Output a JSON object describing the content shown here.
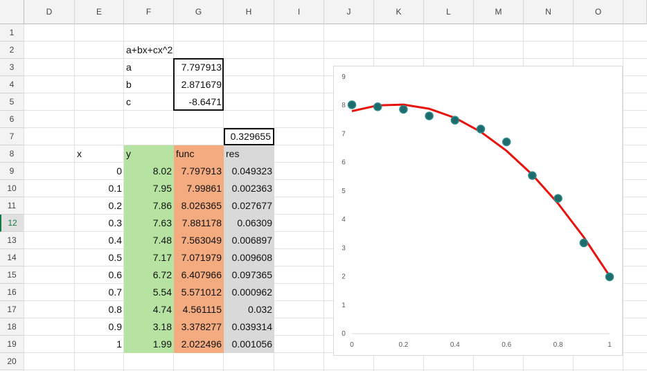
{
  "columns": [
    "D",
    "E",
    "F",
    "G",
    "H",
    "I",
    "J",
    "K",
    "L",
    "M",
    "N",
    "O"
  ],
  "rows": [
    "1",
    "2",
    "3",
    "4",
    "5",
    "6",
    "7",
    "8",
    "9",
    "10",
    "11",
    "12",
    "13",
    "14",
    "15",
    "16",
    "17",
    "18",
    "19",
    "20"
  ],
  "selected_row": "12",
  "formula_label": "a+bx+cx^2",
  "params": [
    {
      "name": "a",
      "value": "7.797913"
    },
    {
      "name": "b",
      "value": "2.871679"
    },
    {
      "name": "c",
      "value": "-8.6471"
    }
  ],
  "residual_sum": "0.329655",
  "table": {
    "headers": {
      "x": "x",
      "y": "y",
      "func": "func",
      "res": "res"
    },
    "rows": [
      {
        "x": "0",
        "y": "8.02",
        "func": "7.797913",
        "res": "0.049323"
      },
      {
        "x": "0.1",
        "y": "7.95",
        "func": "7.99861",
        "res": "0.002363"
      },
      {
        "x": "0.2",
        "y": "7.86",
        "func": "8.026365",
        "res": "0.027677"
      },
      {
        "x": "0.3",
        "y": "7.63",
        "func": "7.881178",
        "res": "0.06309"
      },
      {
        "x": "0.4",
        "y": "7.48",
        "func": "7.563049",
        "res": "0.006897"
      },
      {
        "x": "0.5",
        "y": "7.17",
        "func": "7.071979",
        "res": "0.009608"
      },
      {
        "x": "0.6",
        "y": "6.72",
        "func": "6.407966",
        "res": "0.097365"
      },
      {
        "x": "0.7",
        "y": "5.54",
        "func": "5.571012",
        "res": "0.000962"
      },
      {
        "x": "0.8",
        "y": "4.74",
        "func": "4.561115",
        "res": "0.032"
      },
      {
        "x": "0.9",
        "y": "3.18",
        "func": "3.378277",
        "res": "0.039314"
      },
      {
        "x": "1",
        "y": "1.99",
        "func": "2.022496",
        "res": "0.001056"
      }
    ]
  },
  "colors": {
    "y_fill": "#b6e3a1",
    "func_fill": "#f4ab80",
    "res_fill": "#d9d9d9",
    "marker": "#1f6b6b",
    "line": "#e8120c"
  },
  "chart_data": {
    "type": "scatter",
    "title": "",
    "xlabel": "",
    "ylabel": "",
    "xlim": [
      0,
      1
    ],
    "ylim": [
      0,
      9
    ],
    "x_ticks": [
      "0",
      "0.2",
      "0.4",
      "0.6",
      "0.8",
      "1"
    ],
    "y_ticks": [
      "0",
      "1",
      "2",
      "3",
      "4",
      "5",
      "6",
      "7",
      "8",
      "9"
    ],
    "series": [
      {
        "type": "scatter",
        "x": [
          0,
          0.1,
          0.2,
          0.3,
          0.4,
          0.5,
          0.6,
          0.7,
          0.8,
          0.9,
          1
        ],
        "y": [
          8.02,
          7.95,
          7.86,
          7.63,
          7.48,
          7.17,
          6.72,
          5.54,
          4.74,
          3.18,
          1.99
        ]
      },
      {
        "type": "line",
        "x": [
          0,
          0.1,
          0.2,
          0.3,
          0.4,
          0.5,
          0.6,
          0.7,
          0.8,
          0.9,
          1
        ],
        "y": [
          7.797913,
          7.99861,
          8.026365,
          7.881178,
          7.563049,
          7.071979,
          6.407966,
          5.571012,
          4.561115,
          3.378277,
          2.022496
        ]
      }
    ],
    "grid": false,
    "legend": "none"
  }
}
